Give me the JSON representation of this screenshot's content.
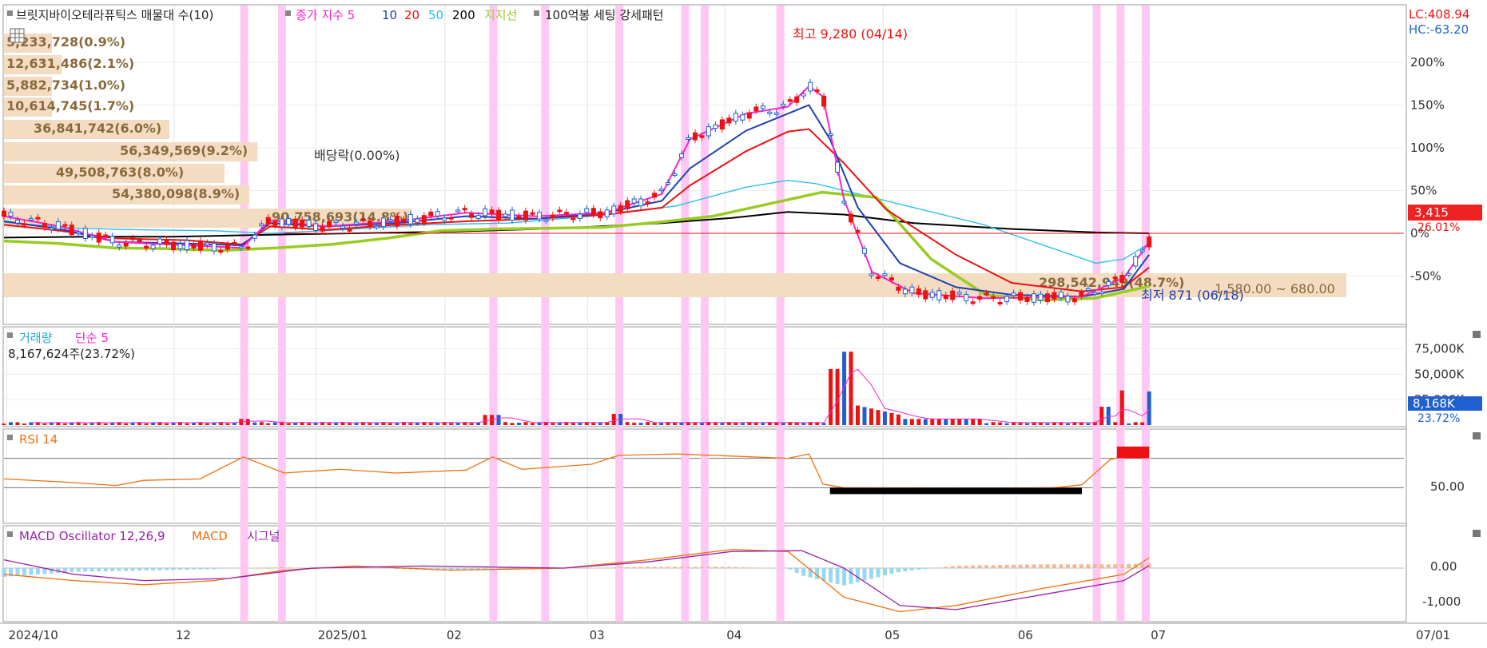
{
  "colors": {
    "ma5": "#ff22cc",
    "ma10": "#1f3fb0",
    "ma20": "#ee1111",
    "ma50": "#22bbee",
    "ma200": "#000000",
    "support": "#99cc22",
    "up": "#ee1111",
    "down": "#1f5fd0",
    "highlight": "#ffc8f4",
    "profile": "#f4dcc3",
    "rsi": "#f07010",
    "macd": "#f07010",
    "signal": "#9922aa",
    "osc_pos": "#f4b896",
    "osc_neg": "#99d8f0",
    "lc": "#ee1111",
    "hc": "#2266cc"
  },
  "price_panel": {
    "title": "브릿지바이오테라퓨틱스 매물대 수(10)",
    "ma_label": "종가 지수 5",
    "ma10": "10",
    "ma20": "20",
    "ma50": "50",
    "ma200": "200",
    "support_label": "지지선",
    "pattern_label": "100억봉 세팅 강세패턴",
    "lc": "LC:408.94",
    "hc": "HC:-63.20",
    "current_price": "3,415",
    "current_pct": "26.01%",
    "high_label": "최고 9,280 (04/14)",
    "low_label": "최저 871 (06/18)",
    "dividend_label": "배당락(0.00%)",
    "range_label": "1,580.00 ~ 680.00",
    "y_ticks": [
      "200%",
      "150%",
      "100%",
      "50%",
      "0%",
      "-50%"
    ]
  },
  "volume_profile": [
    {
      "text": "5,233,728(0.9%)",
      "pct": 0.9
    },
    {
      "text": "12,631,486(2.1%)",
      "pct": 2.1
    },
    {
      "text": "5,882,734(1.0%)",
      "pct": 1.0
    },
    {
      "text": "10,614,745(1.7%)",
      "pct": 1.7
    },
    {
      "text": "36,841,742(6.0%)",
      "pct": 6.0
    },
    {
      "text": "56,349,569(9.2%)",
      "pct": 9.2
    },
    {
      "text": "49,508,763(8.0%)",
      "pct": 8.0
    },
    {
      "text": "54,380,098(8.9%)",
      "pct": 8.9
    },
    {
      "text": "90,758,693(14.8%)",
      "pct": 14.8
    },
    {
      "text": "298,542,949(48.7%)",
      "pct": 48.7
    }
  ],
  "volume_panel": {
    "title": "거래량",
    "ma_label": "단순 5",
    "info": "8,167,624주(23.72%)",
    "y_ticks": [
      "75,000K",
      "50,000K",
      "25,000K"
    ],
    "current": "8,168K",
    "current_pct": "23.72%"
  },
  "rsi_panel": {
    "title": "RSI 14",
    "y_tick": "50.00"
  },
  "macd_panel": {
    "title": "MACD Oscillator 12,26,9",
    "macd_label": "MACD",
    "signal_label": "시그널",
    "y_ticks": [
      "0.00",
      "-1,000"
    ]
  },
  "x_axis": [
    "2024/10",
    "12",
    "2025/01",
    "02",
    "03",
    "04",
    "05",
    "06",
    "07",
    "07/01"
  ],
  "chart_data": {
    "type": "line",
    "title": "브릿지바이오테라퓨틱스",
    "x_labels": [
      "2024/10",
      "12",
      "2025/01",
      "02",
      "03",
      "04",
      "05",
      "06",
      "07"
    ],
    "price_axis_pct": [
      -50,
      0,
      50,
      100,
      150,
      200
    ],
    "high": {
      "price": 9280,
      "date": "04/14"
    },
    "low": {
      "price": 871,
      "date": "06/18"
    },
    "current": {
      "price": 3415,
      "change_pct": 26.01
    },
    "support_path_pct": [
      -9,
      -12,
      -17,
      -18,
      -20,
      -17,
      -13,
      -6,
      3,
      5,
      6,
      7,
      13,
      20,
      34,
      48,
      42,
      -30,
      -72,
      -78,
      -76,
      -62
    ],
    "ma200_path_pct": [
      -7,
      -7,
      -6,
      -5,
      -4,
      -3,
      -1,
      2,
      4,
      7,
      10,
      17,
      25,
      35,
      38,
      32,
      25,
      18,
      12,
      7,
      4
    ],
    "rsi_y_range": [
      0,
      100
    ],
    "volume_unit": "K"
  }
}
